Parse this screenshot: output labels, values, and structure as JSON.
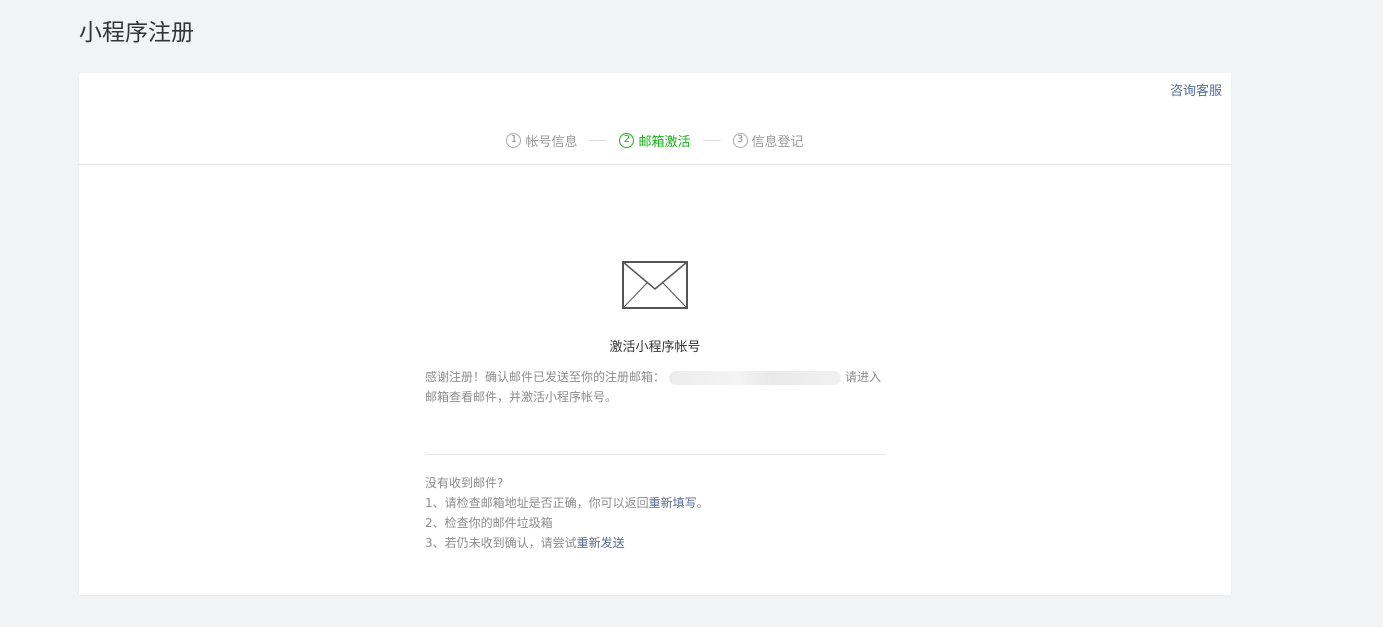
{
  "page": {
    "title": "小程序注册"
  },
  "header": {
    "help_link": "咨询客服"
  },
  "steps": [
    {
      "num": "1",
      "label": "帐号信息",
      "active": false
    },
    {
      "num": "2",
      "label": "邮箱激活",
      "active": true
    },
    {
      "num": "3",
      "label": "信息登记",
      "active": false
    }
  ],
  "main": {
    "icon": "envelope-icon",
    "title": "激活小程序帐号",
    "notice_prefix": "感谢注册！确认邮件已发送至你的注册邮箱：",
    "notice_suffix": "请进入邮箱查看邮件，并激活小程序帐号。"
  },
  "tips": {
    "heading": "没有收到邮件?",
    "item1_prefix": "1、请检查邮箱地址是否正确，你可以返回",
    "item1_link": "重新填写",
    "item1_suffix": "。",
    "item2": "2、检查你的邮件垃圾箱",
    "item3_prefix": "3、若仍未收到确认，请尝试",
    "item3_link": "重新发送"
  },
  "colors": {
    "accent_green": "#1aad19",
    "link_blue": "#576b95",
    "background": "#f2f3f5"
  }
}
